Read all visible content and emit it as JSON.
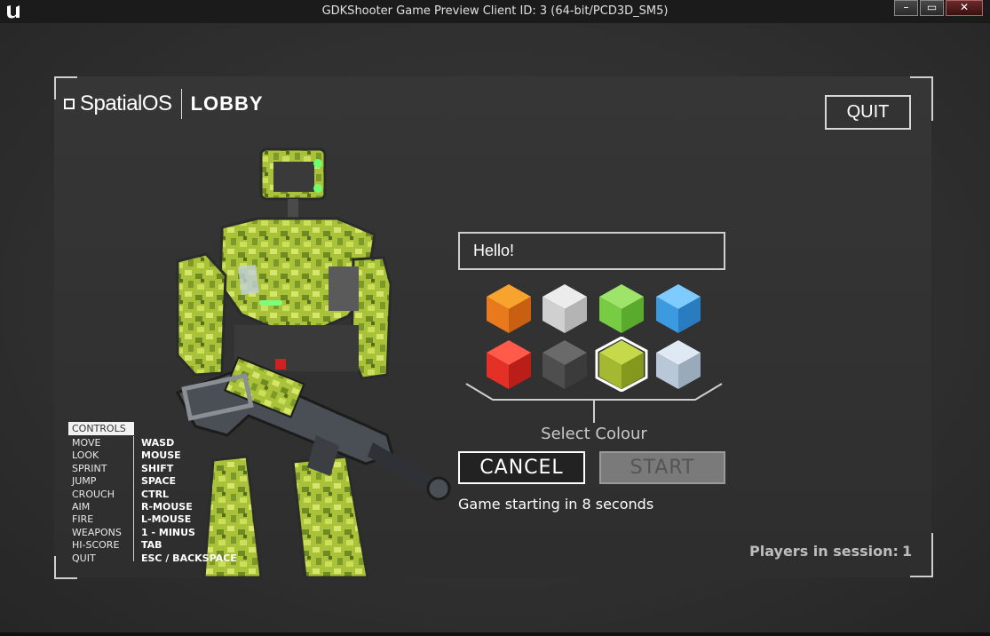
{
  "window": {
    "title": "GDKShooter Game Preview Client ID: 3 (64-bit/PCD3D_SM5)",
    "buttons": {
      "minimize": "–",
      "maximize": "▭",
      "close": "✕"
    }
  },
  "header": {
    "brand": "SpatialOS",
    "section": "LOBBY"
  },
  "quit_label": "QUIT",
  "controls": {
    "heading": "CONTROLS",
    "rows": [
      {
        "action": "MOVE",
        "key": "WASD"
      },
      {
        "action": "LOOK",
        "key": "MOUSE"
      },
      {
        "action": "SPRINT",
        "key": "SHIFT"
      },
      {
        "action": "JUMP",
        "key": "SPACE"
      },
      {
        "action": "CROUCH",
        "key": "CTRL"
      },
      {
        "action": "AIM",
        "key": "R-MOUSE"
      },
      {
        "action": "FIRE",
        "key": "L-MOUSE"
      },
      {
        "action": "WEAPONS",
        "key": "1 - MINUS"
      },
      {
        "action": "HI-SCORE",
        "key": "TAB"
      },
      {
        "action": "QUIT",
        "key": "ESC / BACKSPACE"
      }
    ]
  },
  "name_input": {
    "value": "Hello!"
  },
  "colours": {
    "selected_index": 6,
    "swatches": [
      {
        "name": "orange",
        "top": "#f7a32e",
        "left": "#e8791c",
        "right": "#c95f10"
      },
      {
        "name": "white",
        "top": "#ececec",
        "left": "#d0d0d0",
        "right": "#b4b4b4"
      },
      {
        "name": "green",
        "top": "#9ee36a",
        "left": "#78cc44",
        "right": "#5aaa2e"
      },
      {
        "name": "blue",
        "top": "#7ecbff",
        "left": "#3c9be0",
        "right": "#2a7cc0"
      },
      {
        "name": "red",
        "top": "#ff5a4a",
        "left": "#e53027",
        "right": "#bb1e18"
      },
      {
        "name": "dark-grey",
        "top": "#6a6a6a",
        "left": "#4e4e4e",
        "right": "#3b3b3b"
      },
      {
        "name": "green-camo",
        "top": "#c6d94a",
        "left": "#a4b830",
        "right": "#84981e"
      },
      {
        "name": "white-camo",
        "top": "#dfe9f3",
        "left": "#b8c8d8",
        "right": "#99aabb"
      }
    ],
    "label": "Select Colour"
  },
  "actions": {
    "cancel": "CANCEL",
    "start": "START"
  },
  "status": "Game starting in 8 seconds",
  "players": {
    "label": "Players in session:",
    "count": "1"
  }
}
